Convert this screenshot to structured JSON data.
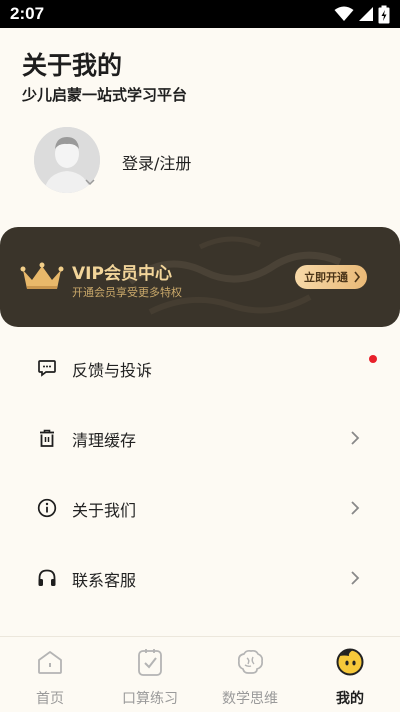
{
  "status_bar": {
    "time": "2:07"
  },
  "header": {
    "title": "关于我的",
    "subtitle": "少儿启蒙一站式学习平台"
  },
  "profile": {
    "login_label": "登录/注册"
  },
  "vip": {
    "title": "VIP会员中心",
    "subtitle": "开通会员享受更多特权",
    "button_label": "立即开通"
  },
  "menu": {
    "items": [
      {
        "label": "反馈与投诉",
        "icon": "message-icon",
        "has_badge": true
      },
      {
        "label": "清理缓存",
        "icon": "trash-icon"
      },
      {
        "label": "关于我们",
        "icon": "info-icon"
      },
      {
        "label": "联系客服",
        "icon": "headphones-icon"
      }
    ]
  },
  "tabbar": {
    "tabs": [
      {
        "label": "首页",
        "icon": "home-icon"
      },
      {
        "label": "口算练习",
        "icon": "checklist-icon"
      },
      {
        "label": "数学思维",
        "icon": "brain-icon"
      },
      {
        "label": "我的",
        "icon": "mascot-icon",
        "active": true
      }
    ]
  },
  "colors": {
    "background": "#fdfaf3",
    "vip_card": "#3a342a",
    "vip_gold": "#f2d59a",
    "badge": "#e8202a"
  }
}
